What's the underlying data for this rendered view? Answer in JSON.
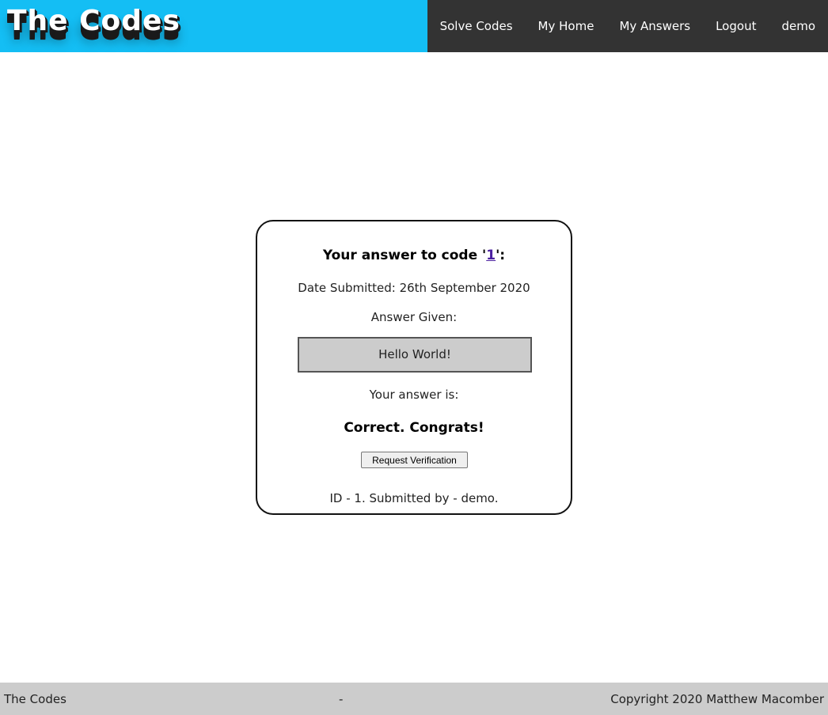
{
  "header": {
    "brand": "The Codes",
    "nav": [
      "Solve Codes",
      "My Home",
      "My Answers",
      "Logout",
      "demo"
    ],
    "brand_color": "#14bef4",
    "nav_bg": "#333333"
  },
  "card": {
    "title_prefix": "Your answer to code '",
    "code_link": "1",
    "title_suffix": "':",
    "date_submitted": "Date Submitted: 26th September 2020",
    "answer_label": "Answer Given:",
    "answer_value": "Hello World!",
    "result_label": "Your answer is:",
    "result_value": "Correct. Congrats!",
    "verify_button": "Request Verification",
    "meta": "ID - 1. Submitted by - demo."
  },
  "footer": {
    "left": "The Codes",
    "center": "-",
    "right": "Copyright 2020 Matthew Macomber",
    "bg": "#cccccc"
  }
}
